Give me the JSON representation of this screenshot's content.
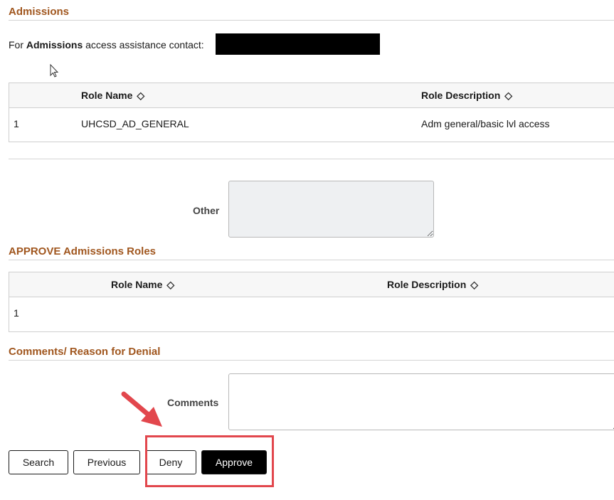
{
  "admissions": {
    "title": "Admissions",
    "contact_prefix": "For",
    "contact_bold": "Admissions",
    "contact_suffix": "access assistance contact:"
  },
  "roles_grid": {
    "col_role_name": "Role Name",
    "col_role_description": "Role Description",
    "sort_icon": "◇",
    "rows": [
      {
        "num": "1",
        "role_name": "UHCSD_AD_GENERAL",
        "role_description": "Adm general/basic lvl access"
      }
    ]
  },
  "other": {
    "label": "Other",
    "value": ""
  },
  "approve_section": {
    "title": "APPROVE Admissions Roles",
    "col_role_name": "Role Name",
    "col_role_description": "Role Description",
    "rows": [
      {
        "num": "1"
      }
    ]
  },
  "comments_section": {
    "title": "Comments/ Reason for Denial",
    "label": "Comments",
    "value": ""
  },
  "buttons": {
    "search": "Search",
    "previous": "Previous",
    "deny": "Deny",
    "approve": "Approve"
  },
  "annotation": {
    "arrow_color": "#e2474d",
    "box_color": "#e2474d"
  },
  "colors": {
    "section_title": "#a0561e",
    "other_bg": "#eef0f2"
  }
}
